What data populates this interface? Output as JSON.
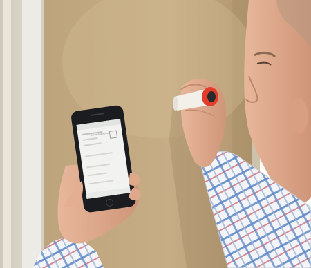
{
  "scene": {
    "description_tags": [
      "photo",
      "wall",
      "smartphone",
      "handheld-meter",
      "person"
    ],
    "colors": {
      "wall": "#c4aa82",
      "wall_shadow": "#a88f68",
      "left_wall": "#d7d2c4",
      "door_trim": "#eeeeea",
      "phone_body": "#1b1c1f",
      "phone_screen": "#f2f3f1",
      "meter_body": "#f1eee8",
      "meter_cap": "#e33d2c",
      "skin": "#dfa88b",
      "shirt_stripe_blue": "#4f7fc2",
      "shirt_stripe_red": "#c85a68",
      "shirt_base": "#f3f4f7"
    }
  },
  "phone": {
    "app_title": "Connected Sensor"
  }
}
